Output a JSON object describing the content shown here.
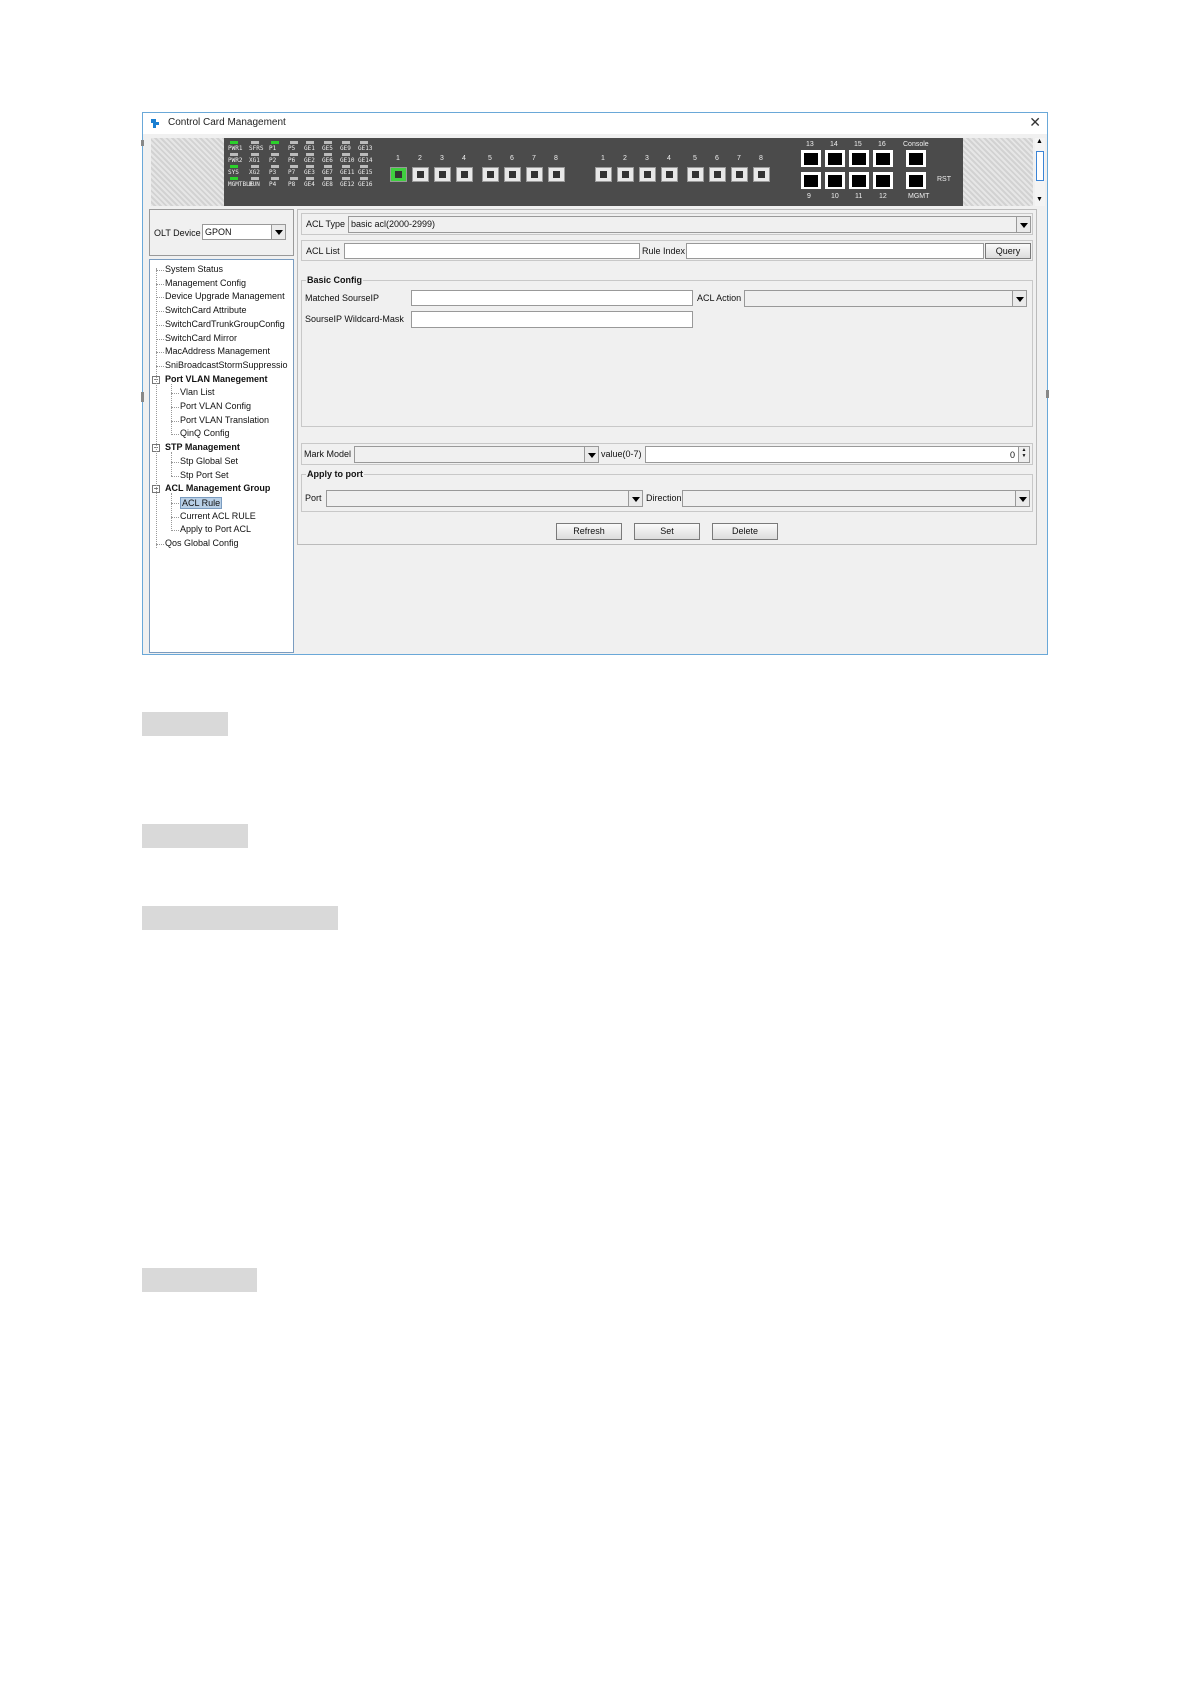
{
  "window": {
    "title": "Control Card Management"
  },
  "device_panel": {
    "left_leds": [
      {
        "label": "PWR1",
        "on": true
      },
      {
        "label": "SFRS",
        "on": false
      },
      {
        "label": "P1",
        "on": true
      },
      {
        "label": "P5",
        "on": false
      },
      {
        "label": "GE1",
        "on": false
      },
      {
        "label": "GE5",
        "on": false
      },
      {
        "label": "GE9",
        "on": false
      },
      {
        "label": "GE13",
        "on": false
      },
      {
        "label": "PWR2",
        "on": false
      },
      {
        "label": "XG1",
        "on": false
      },
      {
        "label": "P2",
        "on": false
      },
      {
        "label": "P6",
        "on": false
      },
      {
        "label": "GE2",
        "on": false
      },
      {
        "label": "GE6",
        "on": false
      },
      {
        "label": "GE10",
        "on": false
      },
      {
        "label": "GE14",
        "on": false
      },
      {
        "label": "SYS",
        "on": true
      },
      {
        "label": "XG2",
        "on": false
      },
      {
        "label": "P3",
        "on": false
      },
      {
        "label": "P7",
        "on": false
      },
      {
        "label": "GE3",
        "on": false
      },
      {
        "label": "GE7",
        "on": false
      },
      {
        "label": "GE11",
        "on": false
      },
      {
        "label": "GE15",
        "on": false
      },
      {
        "label": "MGMTBLE",
        "on": true
      },
      {
        "label": "RUN",
        "on": false
      },
      {
        "label": "P4",
        "on": false
      },
      {
        "label": "P8",
        "on": false
      },
      {
        "label": "GE4",
        "on": false
      },
      {
        "label": "GE8",
        "on": false
      },
      {
        "label": "GE12",
        "on": false
      },
      {
        "label": "GE16",
        "on": false
      }
    ],
    "pon_group_1": [
      "1",
      "2",
      "3",
      "4",
      "5",
      "6",
      "7",
      "8"
    ],
    "pon_group_2": [
      "1",
      "2",
      "3",
      "4",
      "5",
      "6",
      "7",
      "8"
    ],
    "rj45_top": [
      "13",
      "14",
      "15",
      "16"
    ],
    "rj45_bottom": [
      "9",
      "10",
      "11",
      "12"
    ],
    "console_label": "Console",
    "mgmt_label": "MGMT",
    "rst_label": "RST"
  },
  "left": {
    "olt_label": "OLT Device",
    "olt_value": "GPON",
    "tree": [
      {
        "label": "System Status",
        "level": 0,
        "group": false
      },
      {
        "label": "Management Config",
        "level": 0,
        "group": false
      },
      {
        "label": "Device Upgrade Management",
        "level": 0,
        "group": false
      },
      {
        "label": "SwitchCard Attribute",
        "level": 0,
        "group": false
      },
      {
        "label": "SwitchCardTrunkGroupConfig",
        "level": 0,
        "group": false
      },
      {
        "label": "SwitchCard Mirror",
        "level": 0,
        "group": false
      },
      {
        "label": "MacAddress Management",
        "level": 0,
        "group": false
      },
      {
        "label": "SniBroadcastStormSuppressio",
        "level": 0,
        "group": false
      },
      {
        "label": "Port VLAN Manegement",
        "level": 0,
        "group": true
      },
      {
        "label": "Vlan List",
        "level": 1,
        "group": false
      },
      {
        "label": "Port VLAN Config",
        "level": 1,
        "group": false
      },
      {
        "label": "Port VLAN Translation",
        "level": 1,
        "group": false
      },
      {
        "label": "QinQ Config",
        "level": 1,
        "group": false
      },
      {
        "label": "STP Management",
        "level": 0,
        "group": true
      },
      {
        "label": "Stp Global Set",
        "level": 1,
        "group": false
      },
      {
        "label": "Stp Port Set",
        "level": 1,
        "group": false
      },
      {
        "label": "ACL Management Group",
        "level": 0,
        "group": true
      },
      {
        "label": "ACL Rule",
        "level": 1,
        "group": false,
        "selected": true
      },
      {
        "label": "Current ACL RULE",
        "level": 1,
        "group": false
      },
      {
        "label": "Apply to Port ACL",
        "level": 1,
        "group": false
      },
      {
        "label": "Qos Global Config",
        "level": 0,
        "group": false
      }
    ]
  },
  "form": {
    "acl_type_label": "ACL Type",
    "acl_type_value": "basic acl(2000-2999)",
    "acl_list_label": "ACL List",
    "acl_list_value": "",
    "rule_index_label": "Rule Index",
    "rule_index_value": "",
    "query_button": "Query",
    "basic_config_legend": "Basic Config",
    "matched_sourceip_label": "Matched SourseIP",
    "matched_sourceip_value": "",
    "acl_action_label": "ACL Action",
    "acl_action_value": "",
    "sourceip_mask_label": "SourseIP Wildcard-Mask",
    "sourceip_mask_value": "",
    "mark_model_label": "Mark Model",
    "mark_model_value": "",
    "value_label": "value(0-7)",
    "value_value": "0",
    "apply_legend": "Apply to port",
    "port_label": "Port",
    "port_value": "",
    "direction_label": "Direction",
    "direction_value": "",
    "refresh_button": "Refresh",
    "set_button": "Set",
    "delete_button": "Delete"
  }
}
